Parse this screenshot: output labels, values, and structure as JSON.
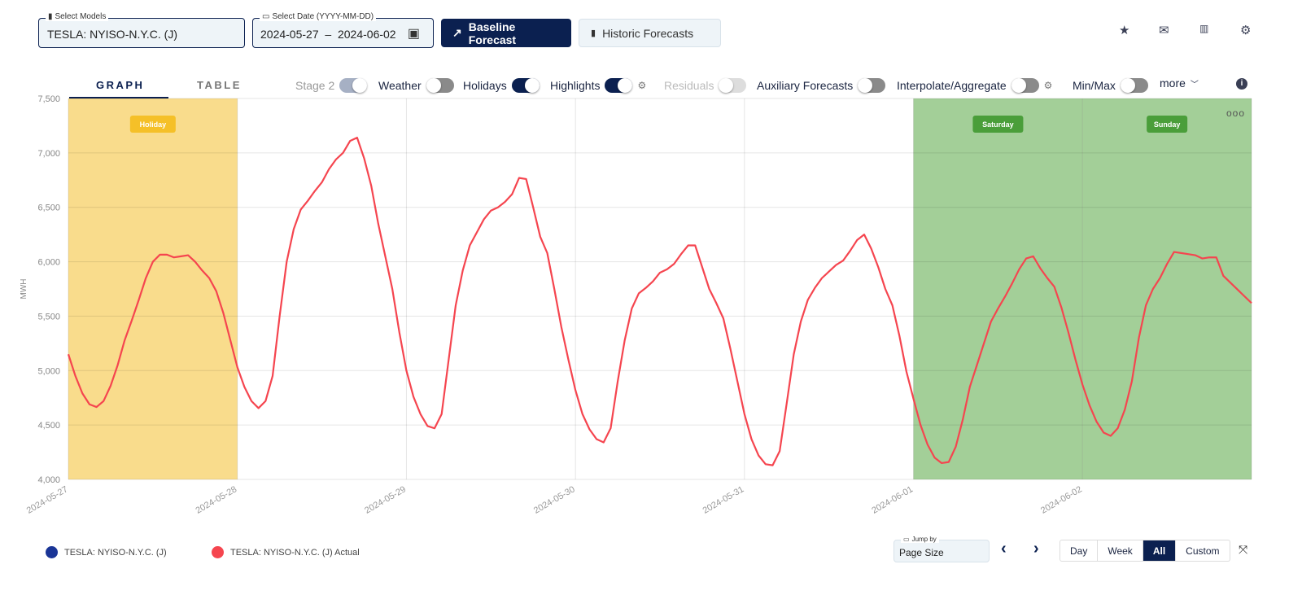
{
  "header": {
    "model_select": {
      "label": "Select Models",
      "value": "TESLA: NYISO-N.Y.C. (J)"
    },
    "date_select": {
      "label": "Select Date (YYYY-MM-DD)",
      "start": "2024-05-27",
      "separator": "–",
      "end": "2024-06-02"
    },
    "baseline_button": "Baseline Forecast",
    "historic_button": "Historic Forecasts",
    "icons": [
      "star-icon",
      "mail-icon",
      "chart-icon",
      "gear-icon"
    ]
  },
  "tabs": [
    {
      "label": "GRAPH",
      "active": true
    },
    {
      "label": "TABLE",
      "active": false
    }
  ],
  "toggles": [
    {
      "label": "Stage 2",
      "state": "disabled-on"
    },
    {
      "label": "Weather",
      "state": "off"
    },
    {
      "label": "Holidays",
      "state": "on"
    },
    {
      "label": "Highlights",
      "state": "on"
    },
    {
      "label": "Residuals",
      "state": "disabled-off"
    },
    {
      "label": "Auxiliary Forecasts",
      "state": "off"
    },
    {
      "label": "Interpolate/Aggregate",
      "state": "off"
    },
    {
      "label": "Min/Max",
      "state": "off"
    }
  ],
  "more_label": "more",
  "chart_data": {
    "type": "line",
    "ylabel": "MWH",
    "ylim": [
      4000,
      7500
    ],
    "yticks": [
      "4,000",
      "4,500",
      "5,000",
      "5,500",
      "6,000",
      "6,500",
      "7,000",
      "7,500"
    ],
    "xticks": [
      "2024-05-27",
      "2024-05-28",
      "2024-05-29",
      "2024-05-30",
      "2024-05-31",
      "2024-06-01",
      "2024-06-02"
    ],
    "grid": true,
    "bands": [
      {
        "label": "Holiday",
        "date": "2024-05-27",
        "color": "#f9dc8c",
        "badge_color": "#f5c028"
      },
      {
        "label": "Saturday",
        "date": "2024-06-01",
        "color": "#a3cf98",
        "badge_color": "#4a9e3a"
      },
      {
        "label": "Sunday",
        "date": "2024-06-02",
        "color": "#a3cf98",
        "badge_color": "#4a9e3a"
      }
    ],
    "series": [
      {
        "name": "TESLA: NYISO-N.Y.C. (J) Actual",
        "color": "#f5454f",
        "hourly_by_day": [
          {
            "date": "2024-05-27",
            "values": [
              5150,
              4950,
              4790,
              4690,
              4665,
              4720,
              4860,
              5050,
              5280,
              5460,
              5650,
              5850,
              6000,
              6065,
              6065,
              6040,
              6050,
              6060,
              6000,
              5920,
              5850,
              5730,
              5530,
              5280
            ]
          },
          {
            "date": "2024-05-28",
            "values": [
              5030,
              4850,
              4720,
              4655,
              4720,
              4950,
              5500,
              6000,
              6300,
              6480,
              6560,
              6650,
              6730,
              6850,
              6940,
              7000,
              7110,
              7140,
              6950,
              6700,
              6350,
              6050,
              5750,
              5350
            ]
          },
          {
            "date": "2024-05-29",
            "values": [
              5000,
              4760,
              4600,
              4490,
              4470,
              4600,
              5100,
              5600,
              5920,
              6150,
              6270,
              6390,
              6470,
              6500,
              6550,
              6620,
              6770,
              6760,
              6500,
              6230,
              6080,
              5750,
              5400,
              5100
            ]
          },
          {
            "date": "2024-05-30",
            "values": [
              4820,
              4600,
              4460,
              4370,
              4340,
              4470,
              4900,
              5280,
              5570,
              5710,
              5760,
              5820,
              5900,
              5930,
              5980,
              6070,
              6150,
              6150,
              5950,
              5750,
              5620,
              5480,
              5200,
              4900
            ]
          },
          {
            "date": "2024-05-31",
            "values": [
              4600,
              4370,
              4220,
              4140,
              4130,
              4260,
              4700,
              5150,
              5450,
              5650,
              5760,
              5850,
              5910,
              5970,
              6010,
              6100,
              6200,
              6250,
              6120,
              5950,
              5750,
              5600,
              5320,
              4990
            ]
          },
          {
            "date": "2024-06-01",
            "values": [
              4740,
              4500,
              4320,
              4200,
              4150,
              4160,
              4300,
              4550,
              4850,
              5050,
              5250,
              5450,
              5570,
              5680,
              5800,
              5930,
              6030,
              6050,
              5940,
              5850,
              5770,
              5580,
              5350,
              5100
            ]
          },
          {
            "date": "2024-06-02",
            "values": [
              4870,
              4680,
              4530,
              4430,
              4400,
              4470,
              4640,
              4900,
              5300,
              5600,
              5750,
              5850,
              5980,
              6090,
              6080,
              6070,
              6060,
              6030,
              6040,
              6040,
              5870,
              5620
            ]
          }
        ]
      }
    ]
  },
  "legend": [
    {
      "label": "TESLA: NYISO-N.Y.C. (J)",
      "color": "#1a3596"
    },
    {
      "label": "TESLA: NYISO-N.Y.C. (J) Actual",
      "color": "#f5454f"
    }
  ],
  "footer": {
    "jump_by": {
      "label": "Jump by",
      "value": "Page Size"
    },
    "ranges": [
      {
        "label": "Day",
        "active": false
      },
      {
        "label": "Week",
        "active": false
      },
      {
        "label": "All",
        "active": true
      },
      {
        "label": "Custom",
        "active": false
      }
    ]
  }
}
